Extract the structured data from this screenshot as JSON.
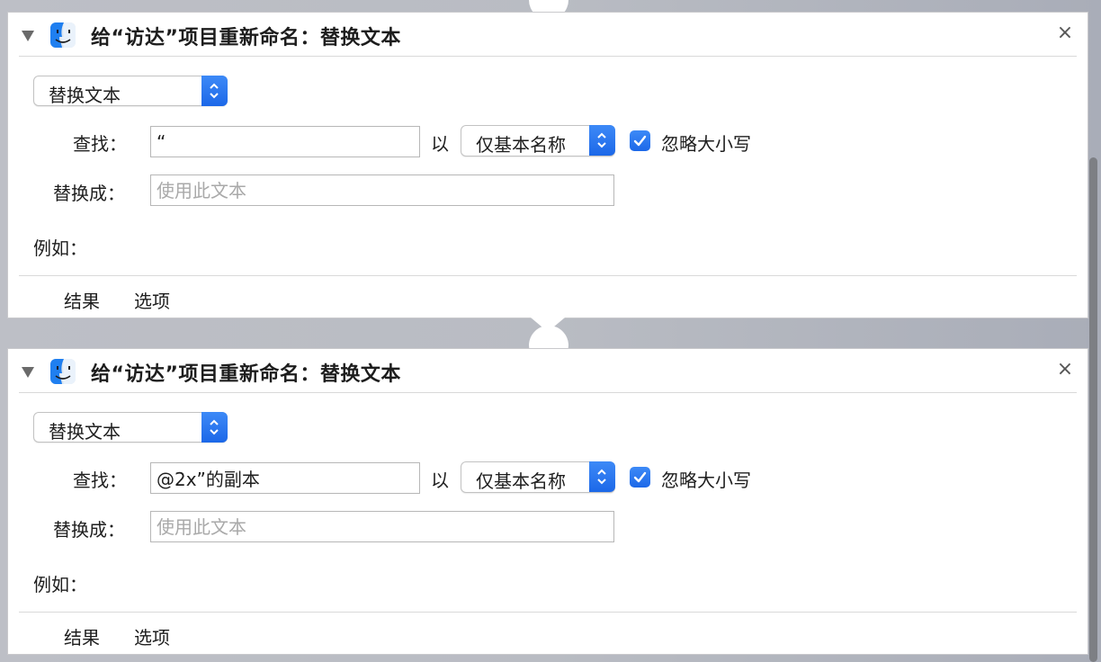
{
  "actions": [
    {
      "title": "给“访达”项目重新命名：替换文本",
      "mode": "替换文本",
      "find_label": "查找：",
      "find_value": "“",
      "with_label": "以",
      "scope": "仅基本名称",
      "ignore_case_checked": true,
      "ignore_case_label": "忽略大小写",
      "replace_label": "替换成：",
      "replace_value": "",
      "replace_placeholder": "使用此文本",
      "example_label": "例如：",
      "tabs": [
        "结果",
        "选项"
      ]
    },
    {
      "title": "给“访达”项目重新命名：替换文本",
      "mode": "替换文本",
      "find_label": "查找：",
      "find_value": "@2x”的副本",
      "with_label": "以",
      "scope": "仅基本名称",
      "ignore_case_checked": true,
      "ignore_case_label": "忽略大小写",
      "replace_label": "替换成：",
      "replace_value": "",
      "replace_placeholder": "使用此文本",
      "example_label": "例如：",
      "tabs": [
        "结果",
        "选项"
      ]
    }
  ],
  "close_glyph": "×",
  "colors": {
    "accent": "#2f7bf5",
    "background": "#bdbfc6"
  }
}
